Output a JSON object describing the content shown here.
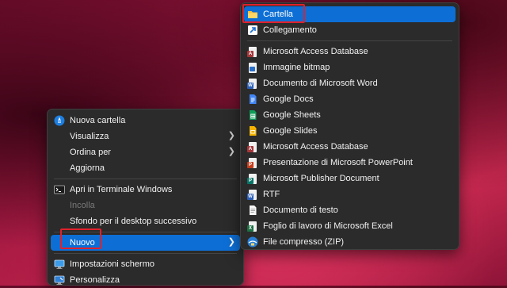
{
  "main_menu": {
    "items": [
      {
        "label": "Nuova cartella",
        "icon": "new-folder-icon"
      },
      {
        "label": "Visualizza",
        "has_submenu": true
      },
      {
        "label": "Ordina per",
        "has_submenu": true
      },
      {
        "label": "Aggiorna"
      },
      {
        "label": "Apri in Terminale Windows",
        "icon": "terminal-icon"
      },
      {
        "label": "Incolla",
        "disabled": true
      },
      {
        "label": "Sfondo per il desktop successivo"
      },
      {
        "label": "Nuovo",
        "has_submenu": true,
        "selected": true
      },
      {
        "label": "Impostazioni schermo",
        "icon": "display-settings-icon"
      },
      {
        "label": "Personalizza",
        "icon": "personalize-icon"
      }
    ]
  },
  "sub_menu": {
    "items": [
      {
        "label": "Cartella",
        "icon": "folder-icon",
        "selected": true
      },
      {
        "label": "Collegamento",
        "icon": "shortcut-icon"
      },
      {
        "label": "Microsoft Access Database",
        "icon": "access-icon"
      },
      {
        "label": "Immagine bitmap",
        "icon": "bitmap-icon"
      },
      {
        "label": "Documento di Microsoft Word",
        "icon": "word-icon"
      },
      {
        "label": "Google Docs",
        "icon": "google-docs-icon"
      },
      {
        "label": "Google Sheets",
        "icon": "google-sheets-icon"
      },
      {
        "label": "Google Slides",
        "icon": "google-slides-icon"
      },
      {
        "label": "Microsoft Access Database",
        "icon": "access-icon"
      },
      {
        "label": "Presentazione di Microsoft PowerPoint",
        "icon": "powerpoint-icon"
      },
      {
        "label": "Microsoft Publisher Document",
        "icon": "publisher-icon"
      },
      {
        "label": "RTF",
        "icon": "rtf-icon"
      },
      {
        "label": "Documento di testo",
        "icon": "text-document-icon"
      },
      {
        "label": "Foglio di lavoro di Microsoft Excel",
        "icon": "excel-icon"
      },
      {
        "label": "File compresso (ZIP)",
        "icon": "zip-icon"
      }
    ]
  },
  "colors": {
    "highlight": "#0d6fd6",
    "annotation_outline": "#e0212b",
    "menu_background": "#2b2b2b"
  }
}
